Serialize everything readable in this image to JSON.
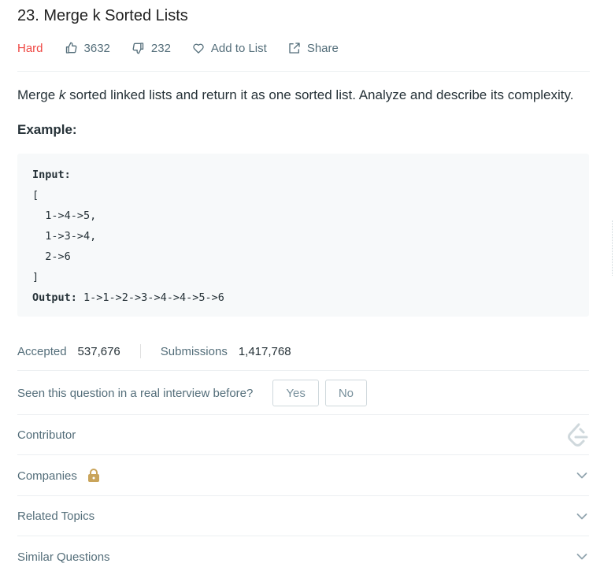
{
  "problem": {
    "title": "23. Merge k Sorted Lists",
    "difficulty": "Hard",
    "likes": "3632",
    "dislikes": "232",
    "add_to_list": "Add to List",
    "share": "Share"
  },
  "description": {
    "before": "Merge ",
    "k": "k",
    "after": " sorted linked lists and return it as one sorted list. Analyze and describe its complexity."
  },
  "example": {
    "label": "Example:",
    "input_label": "Input:",
    "lines": [
      "[",
      "  1->4->5,",
      "  1->3->4,",
      "  2->6",
      "]"
    ],
    "output_label": "Output:",
    "output_value": " 1->1->2->3->4->4->5->6"
  },
  "stats": {
    "accepted_label": "Accepted",
    "accepted_value": "537,676",
    "submissions_label": "Submissions",
    "submissions_value": "1,417,768"
  },
  "interview": {
    "question": "Seen this question in a real interview before?",
    "yes": "Yes",
    "no": "No"
  },
  "sections": {
    "contributor": "Contributor",
    "companies": "Companies",
    "related_topics": "Related Topics",
    "similar_questions": "Similar Questions"
  },
  "icons": {
    "like": "thumbs-up-icon",
    "dislike": "thumbs-down-icon",
    "add": "heart-icon",
    "share": "share-icon",
    "lock": "lock-icon",
    "chevron": "chevron-down-icon",
    "logo": "leetcode-logo-icon"
  },
  "colors": {
    "hard": "#ef4743",
    "lock": "#c9a45a",
    "text": "#263238",
    "muted": "#546e7a"
  }
}
